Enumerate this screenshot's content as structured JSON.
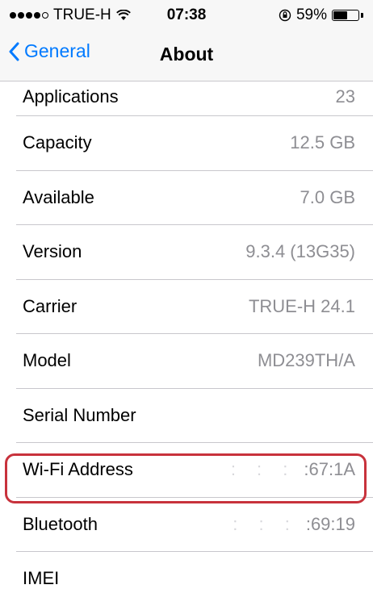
{
  "status_bar": {
    "carrier": "TRUE-H",
    "time": "07:38",
    "battery_percent": "59%",
    "battery_level": 0.59,
    "signal_bars_filled": 4,
    "signal_bars_total": 5,
    "icons": [
      "wifi-icon",
      "orientation-lock-icon",
      "battery-icon"
    ]
  },
  "nav": {
    "back_label": "General",
    "title": "About"
  },
  "rows": [
    {
      "label": "Applications",
      "value": "23"
    },
    {
      "label": "Capacity",
      "value": "12.5 GB"
    },
    {
      "label": "Available",
      "value": "7.0 GB"
    },
    {
      "label": "Version",
      "value": "9.3.4 (13G35)"
    },
    {
      "label": "Carrier",
      "value": "TRUE-H 24.1"
    },
    {
      "label": "Model",
      "value": "MD239TH/A"
    },
    {
      "label": "Serial Number",
      "value": ""
    },
    {
      "label": "Wi-Fi Address",
      "value_dim": ": : :",
      "value": ":67:1A"
    },
    {
      "label": "Bluetooth",
      "value_dim": ": : :",
      "value": ":69:19"
    }
  ],
  "partial_row": {
    "label": "IMEI"
  },
  "colors": {
    "accent": "#007aff",
    "secondary_text": "#8e8e93",
    "highlight": "#c8323c"
  }
}
